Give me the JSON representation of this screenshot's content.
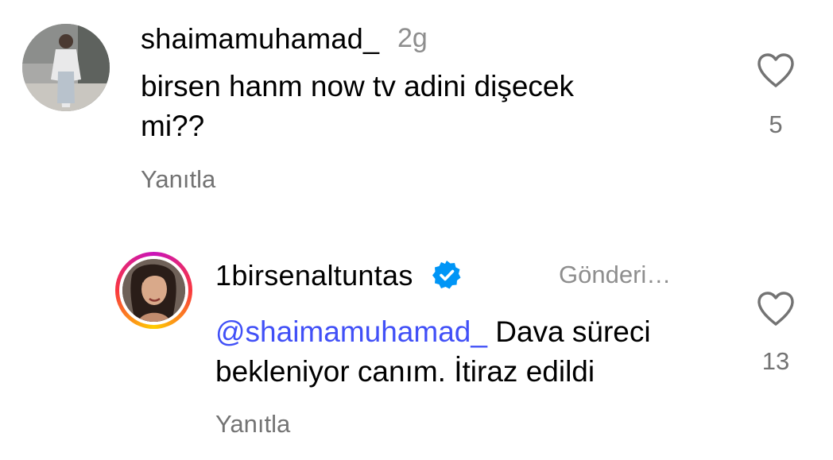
{
  "comments": [
    {
      "username": "shaimamuhamad_",
      "timestamp": "2g",
      "text": "birsen hanm now tv adini dişecek mi??",
      "text_lines": [
        "birsen hanm now tv adini dişecek",
        "mi??"
      ],
      "reply_label": "Yanıtla",
      "like_count": "5",
      "avatar_icon": "user-photo-avatar"
    },
    {
      "username": "1birsenaltuntas",
      "verified": true,
      "timestamp": "Gönderi…",
      "mention": "@shaimamuhamad_",
      "text_after_mention": " Dava süreci",
      "text_line2": "bekleniyor canım. İtiraz edildi",
      "reply_label": "Yanıtla",
      "like_count": "13",
      "avatar_icon": "user-photo-avatar",
      "has_story_ring": true
    }
  ],
  "colors": {
    "mention": "#4150f7",
    "verified_badge": "#0095f6",
    "secondary_text": "#737373",
    "heart_stroke": "#737373"
  },
  "icons": {
    "like": "heart-outline-icon",
    "verified": "verified-badge-icon"
  }
}
